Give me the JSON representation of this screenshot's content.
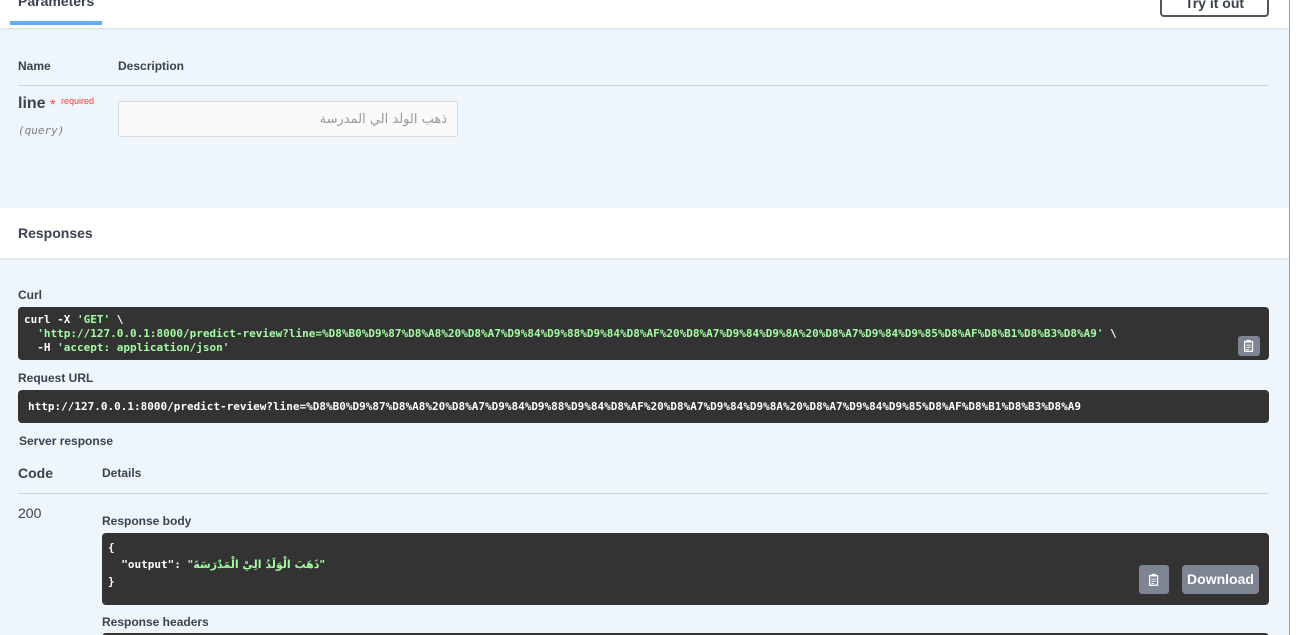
{
  "parameters": {
    "tab_label": "Parameters",
    "try_it_out_label": "Try it out",
    "col_name": "Name",
    "col_description": "Description",
    "param": {
      "name": "line",
      "required_star": "*",
      "required_label": "required",
      "location": "(query)",
      "value": "ذهب الولد الي المدرسة"
    }
  },
  "responses": {
    "title": "Responses",
    "curl_label": "Curl",
    "curl": {
      "line1_cmd": "curl -X ",
      "line1_method": "'GET'",
      "line1_tail": " \\",
      "line2_url": "'http://127.0.0.1:8000/predict-review?line=%D8%B0%D9%87%D8%A8%20%D8%A7%D9%84%D9%88%D9%84%D8%AF%20%D8%A7%D9%84%D9%8A%20%D8%A7%D9%84%D9%85%D8%AF%D8%B1%D8%B3%D8%A9'",
      "line2_tail": " \\",
      "line3_cmd": "-H ",
      "line3_header": "'accept: application/json'"
    },
    "request_url_label": "Request URL",
    "request_url": "http://127.0.0.1:8000/predict-review?line=%D8%B0%D9%87%D8%A8%20%D8%A7%D9%84%D9%88%D9%84%D8%AF%20%D8%A7%D9%84%D9%8A%20%D8%A7%D9%84%D9%85%D8%AF%D8%B1%D8%B3%D8%A9",
    "server_response_label": "Server response",
    "col_code": "Code",
    "col_details": "Details",
    "status_code": "200",
    "response_body_label": "Response body",
    "body": {
      "open": "{",
      "key": "\"output\"",
      "colon": ": ",
      "value": "\"ذَهَبَ الْوَلَدُ الِيْ الْمَدْرَسَةَ\"",
      "close": "}"
    },
    "download_label": "Download",
    "response_headers_label": "Response headers"
  },
  "icons": {
    "copy": "clipboard-icon"
  }
}
